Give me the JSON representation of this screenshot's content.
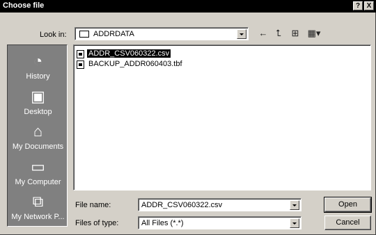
{
  "window": {
    "title": "Choose file",
    "help_label": "?",
    "close_label": "X"
  },
  "toolbar": {
    "look_in_label": "Look in:",
    "look_in_value": "ADDRDATA",
    "back_icon": "back-arrow-icon",
    "up_icon": "up-one-level-icon",
    "new_folder_icon": "new-folder-icon",
    "views_icon": "views-menu-icon"
  },
  "places": [
    {
      "label": "History",
      "icon": "history-icon"
    },
    {
      "label": "Desktop",
      "icon": "desktop-icon"
    },
    {
      "label": "My Documents",
      "icon": "my-documents-icon"
    },
    {
      "label": "My Computer",
      "icon": "my-computer-icon"
    },
    {
      "label": "My Network P...",
      "icon": "network-places-icon"
    }
  ],
  "files": [
    {
      "name": "ADDR_CSV060322.csv",
      "selected": true
    },
    {
      "name": "BACKUP_ADDR060403.tbf",
      "selected": false
    }
  ],
  "form": {
    "file_name_label": "File name:",
    "file_name_value": "ADDR_CSV060322.csv",
    "file_type_label": "Files of type:",
    "file_type_value": "All Files (*.*)"
  },
  "buttons": {
    "open_label": "Open",
    "cancel_label": "Cancel"
  }
}
